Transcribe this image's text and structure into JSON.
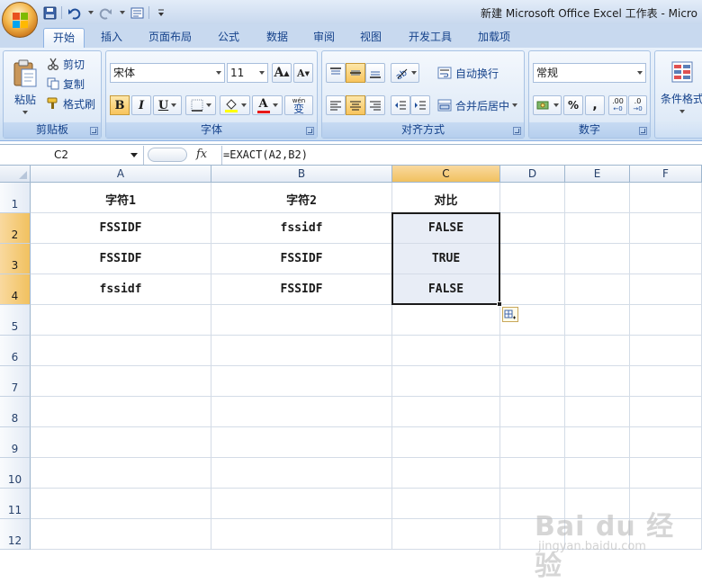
{
  "window": {
    "title": "新建 Microsoft Office Excel 工作表 - Micro"
  },
  "tabs": [
    {
      "label": "开始",
      "active": true
    },
    {
      "label": "插入"
    },
    {
      "label": "页面布局"
    },
    {
      "label": "公式"
    },
    {
      "label": "数据"
    },
    {
      "label": "审阅"
    },
    {
      "label": "视图"
    },
    {
      "label": "开发工具"
    },
    {
      "label": "加载项"
    }
  ],
  "ribbon": {
    "clipboard": {
      "label": "剪贴板",
      "paste": "粘贴",
      "cut": "剪切",
      "copy": "复制",
      "format_painter": "格式刷"
    },
    "font": {
      "label": "字体",
      "font_name": "宋体",
      "font_size": "11",
      "grow": "A",
      "shrink": "A",
      "bold": "B",
      "italic": "I",
      "underline": "U",
      "font_color_letter": "A",
      "phonetic": "wén",
      "phonetic_char": "变"
    },
    "alignment": {
      "label": "对齐方式",
      "wrap_text": "自动换行",
      "merge_center": "合并后居中"
    },
    "number": {
      "label": "数字",
      "format": "常规",
      "percent": "%",
      "comma": ",",
      "inc_decimal": ".00",
      "dec_decimal": ".0"
    },
    "styles": {
      "conditional_format": "条件格式"
    }
  },
  "formula_bar": {
    "name_box": "C2",
    "fx": "fx",
    "formula": "=EXACT(A2,B2)"
  },
  "grid": {
    "columns": [
      "A",
      "B",
      "C",
      "D",
      "E",
      "F"
    ],
    "selected_column": "C",
    "rows": [
      "1",
      "2",
      "3",
      "4",
      "5",
      "6",
      "7",
      "8",
      "9",
      "10",
      "11",
      "12"
    ],
    "selected_rows": [
      "2",
      "3",
      "4"
    ],
    "cells": [
      [
        "字符1",
        "字符2",
        "对比"
      ],
      [
        "FSSIDF",
        "fssidf",
        "FALSE"
      ],
      [
        "FSSIDF",
        "FSSIDF",
        "TRUE"
      ],
      [
        "fssidf",
        "FSSIDF",
        "FALSE"
      ]
    ]
  },
  "watermark": {
    "text": "Bai du 经验",
    "url": "jingyan.baidu.com"
  },
  "colors": {
    "ribbon_text": "#15428b",
    "selection_header": "#f1c15f",
    "selection_fill": "#e8edf6"
  }
}
